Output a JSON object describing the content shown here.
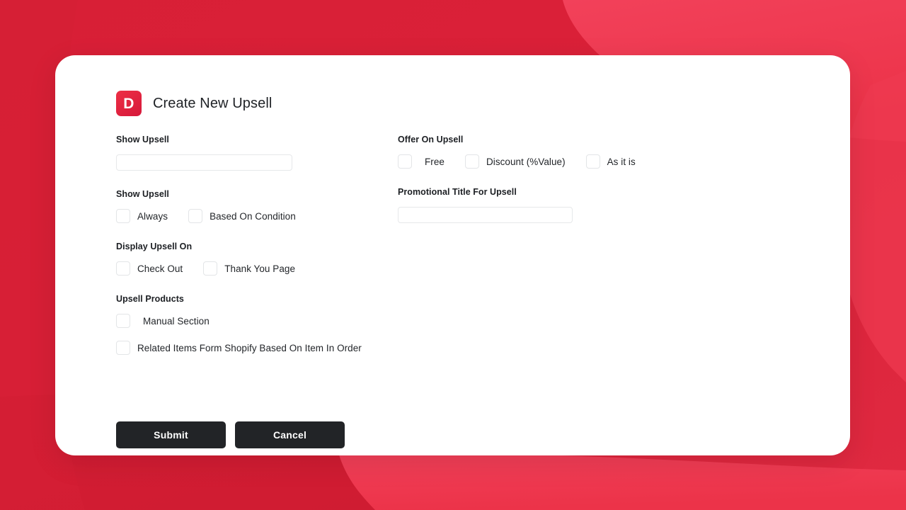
{
  "background": {
    "base_color": "#da2037",
    "light_color": "#ef3b52",
    "dark_color": "#d01e34"
  },
  "card": {
    "background": "#ffffff"
  },
  "header": {
    "logo_letter": "D",
    "logo_color": "#e5243d",
    "title": "Create New Upsell"
  },
  "form": {
    "left": {
      "show_upsell_name": {
        "label": "Show Upsell",
        "value": "",
        "placeholder": ""
      },
      "show_upsell_mode": {
        "label": "Show Upsell",
        "options": [
          {
            "label": "Always",
            "checked": false
          },
          {
            "label": "Based On Condition",
            "checked": false
          }
        ]
      },
      "display_upsell_on": {
        "label": "Display Upsell On",
        "options": [
          {
            "label": "Check Out",
            "checked": false
          },
          {
            "label": "Thank You Page",
            "checked": false
          }
        ]
      },
      "upsell_products": {
        "label": "Upsell Products",
        "options": [
          {
            "label": "Manual Section",
            "checked": false
          },
          {
            "label": "Related Items Form Shopify Based On Item In Order",
            "checked": false
          }
        ]
      }
    },
    "right": {
      "offer_on_upsell": {
        "label": "Offer On Upsell",
        "options": [
          {
            "label": "Free",
            "checked": false
          },
          {
            "label": "Discount (%Value)",
            "checked": false
          },
          {
            "label": "As it is",
            "checked": false
          }
        ]
      },
      "promotional_title": {
        "label": "Promotional Title For Upsell",
        "value": "",
        "placeholder": ""
      }
    }
  },
  "actions": {
    "submit_label": "Submit",
    "cancel_label": "Cancel",
    "button_color": "#222427"
  }
}
